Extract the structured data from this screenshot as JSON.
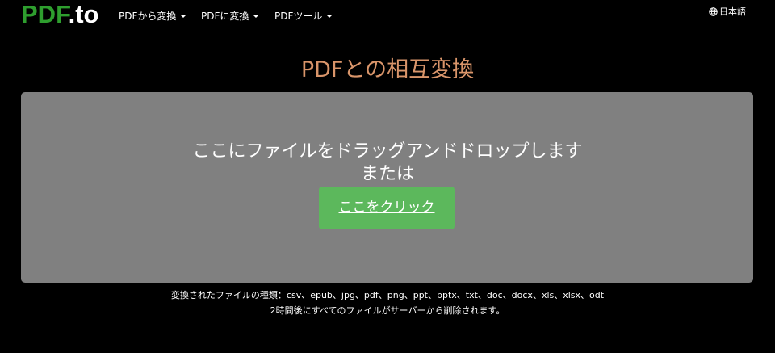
{
  "logo": {
    "part1": "PDF",
    "part2": ".to"
  },
  "nav": {
    "items": [
      {
        "label": "PDFから変換"
      },
      {
        "label": "PDFに変換"
      },
      {
        "label": "PDFツール"
      }
    ],
    "language": "日本語"
  },
  "page_title": "PDFとの相互変換",
  "dropzone": {
    "instruction": "ここにファイルをドラッグアンドドロップします",
    "or": "または",
    "button_label": "ここをクリック"
  },
  "footer": {
    "types": "変換されたファイルの種類：csv、epub、jpg、pdf、png、ppt、pptx、txt、doc、docx、xls、xlsx、odt",
    "note": "2時間後にすべてのファイルがサーバーから削除されます。"
  },
  "colors": {
    "background": "#000000",
    "logo_green": "#2e9e2e",
    "title": "#d9956a",
    "dropzone": "#808080",
    "button": "#5cb85c"
  }
}
